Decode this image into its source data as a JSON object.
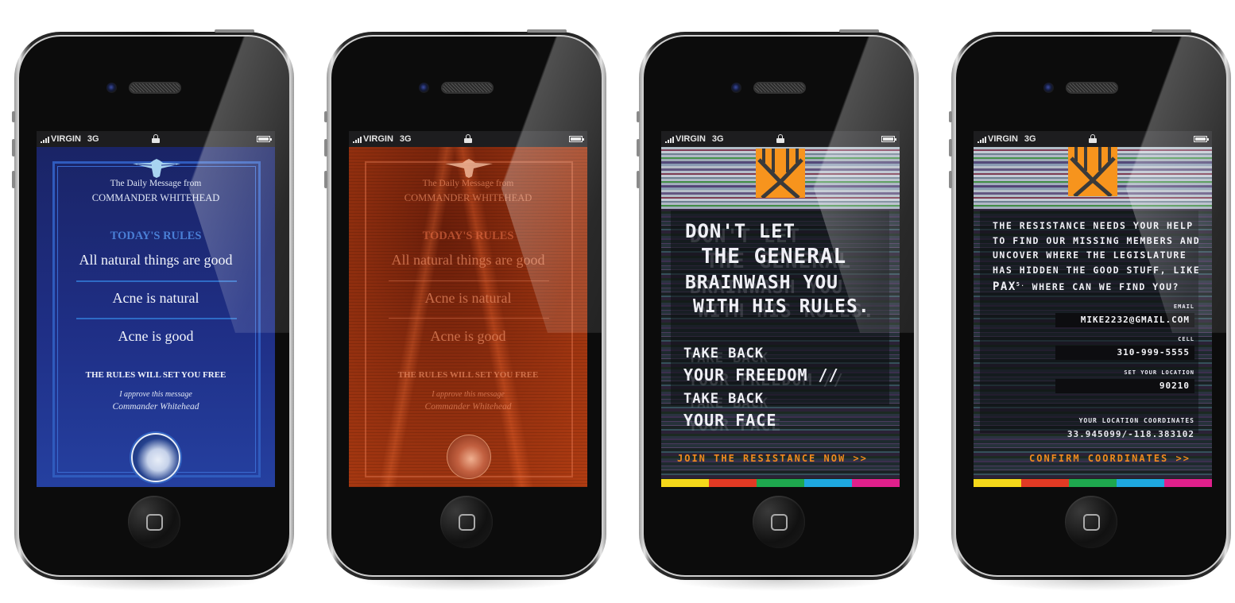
{
  "status_bar": {
    "carrier": "VIRGIN",
    "network": "3G"
  },
  "phones": [
    {
      "theme": "official-blue",
      "header_line1": "The Daily Message from",
      "header_line2": "COMMANDER WHITEHEAD",
      "rules_title": "TODAY'S RULES",
      "rules": [
        "All natural things are good",
        "Acne is natural",
        "Acne is good"
      ],
      "slogan": "THE RULES WILL SET YOU FREE",
      "approval": "I approve this message",
      "signature": "Commander Whitehead",
      "colors": {
        "background": "#1f2f86",
        "frame": "#2f5bbd",
        "accent": "#4a7fd6",
        "text": "#dfe6f5"
      }
    },
    {
      "theme": "corrupted-orange",
      "header_line1": "The Daily Message from",
      "header_line2": "COMMANDER WHITEHEAD",
      "rules_title": "TODAY'S RULES",
      "rules": [
        "All natural things are good",
        "Acne is natural",
        "Acne is good"
      ],
      "slogan": "THE RULES WILL SET YOU FREE",
      "approval": "I approve this message",
      "signature": "Commander Whitehead",
      "colors": {
        "background": "#a8380f",
        "text": "#eb8c64"
      }
    },
    {
      "theme": "resistance-glitch",
      "headline": [
        "DON'T LET",
        "THE GENERAL",
        "BRAINWASH YOU",
        "WITH HIS RULES."
      ],
      "subhead": [
        "TAKE BACK",
        "YOUR FREEDOM //",
        "TAKE BACK",
        "YOUR FACE"
      ],
      "cta": "JOIN THE RESISTANCE NOW >>",
      "colors": {
        "logo": "#f7941d",
        "cta": "#f08a1e"
      }
    },
    {
      "theme": "resistance-form",
      "message": [
        "THE RESISTANCE NEEDS YOUR HELP",
        "TO FIND OUR MISSING MEMBERS AND",
        "UNCOVER WHERE THE LEGISLATURE",
        "HAS HIDDEN THE GOOD STUFF, LIKE"
      ],
      "message_pax": "PAX",
      "message_sup": "5.",
      "message_end": " WHERE CAN WE FIND YOU?",
      "fields": {
        "email_label": "EMAIL",
        "email_value": "MIKE2232@GMAIL.COM",
        "cell_label": "CELL",
        "cell_value": "310-999-5555",
        "location_label": "SET YOUR LOCATION",
        "location_value": "90210"
      },
      "coords_label": "YOUR LOCATION COORDINATES",
      "coords_value": "33.945099/-118.383102",
      "cta": "CONFIRM COORDINATES >>"
    }
  ],
  "color_bar": [
    "#f5d81a",
    "#e23a24",
    "#1ea84e",
    "#1ea8e0",
    "#e0208c"
  ]
}
